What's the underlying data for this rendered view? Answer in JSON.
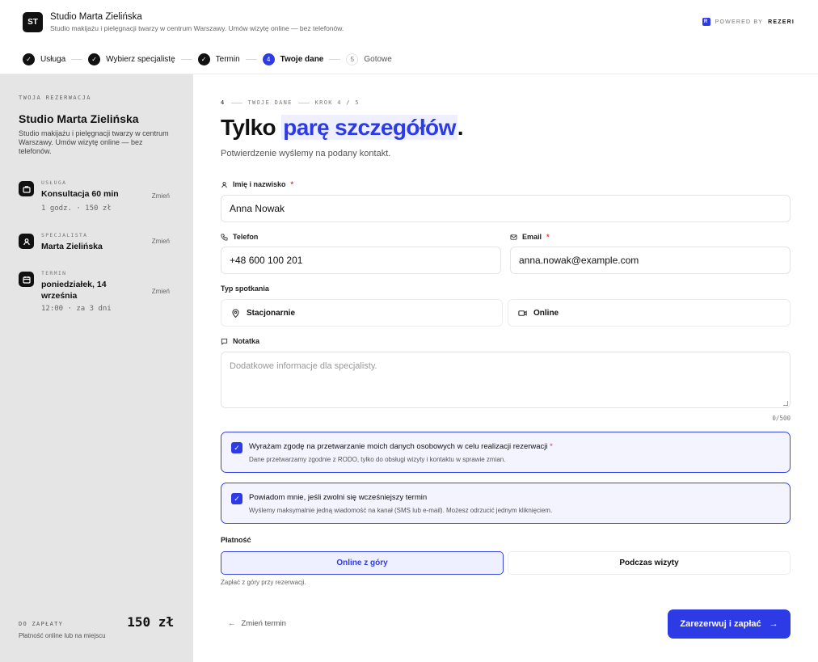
{
  "header": {
    "logo_initials": "ST",
    "studio_name": "Studio Marta Zielińska",
    "studio_description": "Studio makijażu i pielęgnacji twarzy w centrum Warszawy. Umów wizytę online — bez telefonów.",
    "powered_prefix": "POWERED BY",
    "powered_brand": "REZERI",
    "powered_badge": "R"
  },
  "stepper": {
    "steps": [
      {
        "label": "Usługa",
        "state": "done"
      },
      {
        "label": "Wybierz specjalistę",
        "state": "done"
      },
      {
        "label": "Termin",
        "state": "done"
      },
      {
        "label": "Twoje dane",
        "state": "active",
        "number": "4"
      },
      {
        "label": "Gotowe",
        "state": "future",
        "number": "5"
      }
    ]
  },
  "sidebar": {
    "kicker": "TWOJA REZERWACJA",
    "title": "Studio Marta Zielińska",
    "description": "Studio makijażu i pielęgnacji twarzy w centrum Warszawy. Umów wizytę online — bez telefonów.",
    "change_label": "Zmień",
    "service": {
      "label": "USŁUGA",
      "value": "Konsultacja 60 min",
      "sub": "1 godz. · 150 zł"
    },
    "specialist": {
      "label": "SPECJALISTA",
      "value": "Marta Zielińska"
    },
    "term": {
      "label": "TERMIN",
      "value": "poniedziałek, 14 września",
      "sub": "12:00 · za 3 dni"
    },
    "payment_label": "DO ZAPŁATY",
    "payment_sub": "Płatność online lub na miejscu",
    "payment_amount": "150 zł"
  },
  "main": {
    "crumb_number": "4",
    "crumb_title": "TWOJE DANE",
    "crumb_step": "KROK 4 / 5",
    "heading_plain": "Tylko ",
    "heading_highlight": "parę szczegółów",
    "heading_end": ".",
    "subtitle": "Potwierdzenie wyślemy na podany kontakt.",
    "name": {
      "label": "Imię i nazwisko",
      "required": "*",
      "value": "Anna Nowak"
    },
    "phone": {
      "label": "Telefon",
      "value": "+48 600 100 201"
    },
    "email": {
      "label": "Email",
      "required": "*",
      "value": "anna.nowak@example.com"
    },
    "meeting_type": {
      "label": "Typ spotkania",
      "options": [
        "Stacjonarnie",
        "Online"
      ]
    },
    "note": {
      "label": "Notatka",
      "placeholder": "Dodatkowe informacje dla specjalisty.",
      "counter": "0/500"
    },
    "consent_gdpr": {
      "title": "Wyrażam zgodę na przetwarzanie moich danych osobowych w celu realizacji rezerwacji",
      "required": "*",
      "sub": "Dane przetwarzamy zgodnie z RODO, tylko do obsługi wizyty i kontaktu w sprawie zmian.",
      "checked": true
    },
    "consent_notify": {
      "title": "Powiadom mnie, jeśli zwolni się wcześniejszy termin",
      "sub": "Wyślemy maksymalnie jedną wiadomość na kanał (SMS lub e-mail). Możesz odrzucić jednym kliknięciem.",
      "checked": true
    },
    "payment": {
      "label": "Płatność",
      "options": [
        "Online z góry",
        "Podczas wizyty"
      ],
      "selected": "Online z góry",
      "note": "Zapłać z góry przy rezerwacji."
    },
    "back_label": "Zmień termin",
    "submit_label": "Zarezerwuj i zapłać"
  },
  "colors": {
    "accent": "#2d3be6",
    "sidebar_bg": "#e5e5e5",
    "required": "#e23a3a"
  }
}
